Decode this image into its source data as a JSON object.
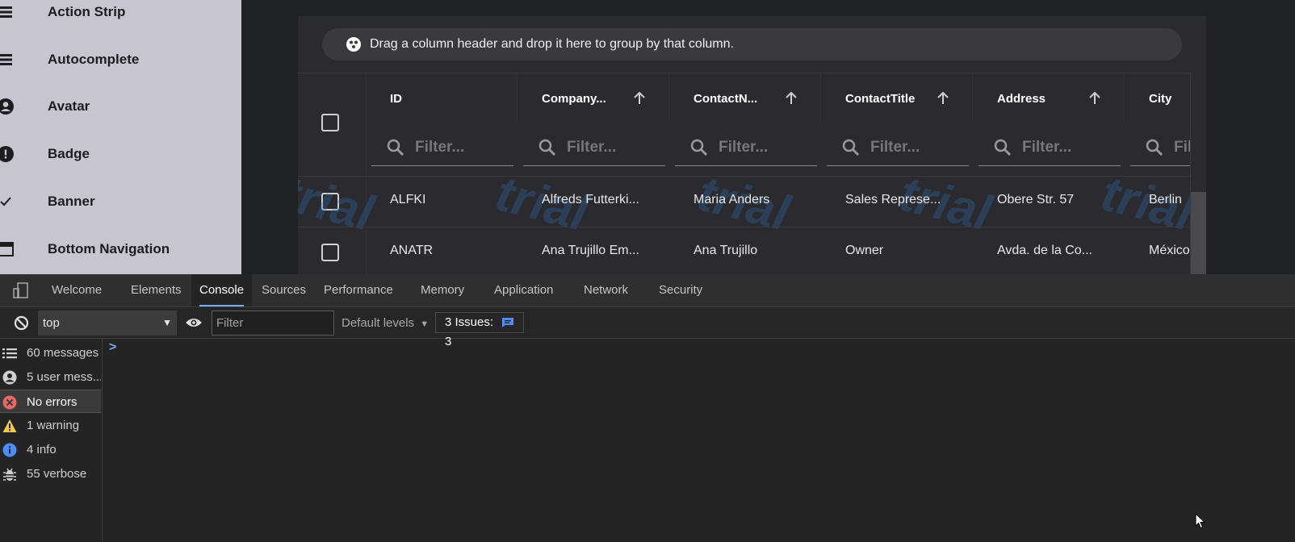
{
  "sidebar": {
    "items": [
      {
        "label": "Action Strip",
        "icon": "list-icon"
      },
      {
        "label": "Autocomplete",
        "icon": "list-icon"
      },
      {
        "label": "Avatar",
        "icon": "account-circle-icon"
      },
      {
        "label": "Badge",
        "icon": "error-circle-icon"
      },
      {
        "label": "Banner",
        "icon": "check-icon"
      },
      {
        "label": "Bottom Navigation",
        "icon": "web-asset-icon"
      }
    ]
  },
  "grid": {
    "group_area_text": "Drag a column header and drop it here to group by that column.",
    "columns": [
      {
        "title": "ID",
        "sortable_icon": false
      },
      {
        "title": "Company...",
        "sortable_icon": true
      },
      {
        "title": "ContactN...",
        "sortable_icon": true
      },
      {
        "title": "ContactTitle",
        "sortable_icon": true
      },
      {
        "title": "Address",
        "sortable_icon": true
      },
      {
        "title": "City",
        "sortable_icon": false
      }
    ],
    "filter_placeholder": "Filter...",
    "filter_partial": "Fil",
    "rows": [
      [
        "ALFKI",
        "Alfreds Futterki...",
        "Maria Anders",
        "Sales Represe...",
        "Obere Str. 57",
        "Berlin"
      ],
      [
        "ANATR",
        "Ana Trujillo Em...",
        "Ana Trujillo",
        "Owner",
        "Avda. de la Co...",
        "México"
      ]
    ],
    "watermark": "trial"
  },
  "devtools": {
    "tabs": [
      "Welcome",
      "Elements",
      "Console",
      "Sources",
      "Performance",
      "Memory",
      "Application",
      "Network",
      "Security"
    ],
    "active_tab": "Console",
    "context": "top",
    "filter_placeholder": "Filter",
    "levels_label": "Default levels",
    "issues_label": "3 Issues:",
    "issues_count": "3",
    "prompt": ">",
    "messages": [
      {
        "label": "60 messages",
        "icon": "list-icon"
      },
      {
        "label": "5 user mess...",
        "icon": "user-icon"
      },
      {
        "label": "No errors",
        "icon": "error-icon",
        "color": "#e46962"
      },
      {
        "label": "1 warning",
        "icon": "warning-icon",
        "color": "#f2c94c"
      },
      {
        "label": "4 info",
        "icon": "info-icon",
        "color": "#4c8df6"
      },
      {
        "label": "55 verbose",
        "icon": "bug-icon"
      }
    ]
  },
  "colors": {
    "sidebar_bg": "#c7c5d0",
    "grid_bg": "#2b2a2e",
    "accent": "#7cacf8"
  }
}
